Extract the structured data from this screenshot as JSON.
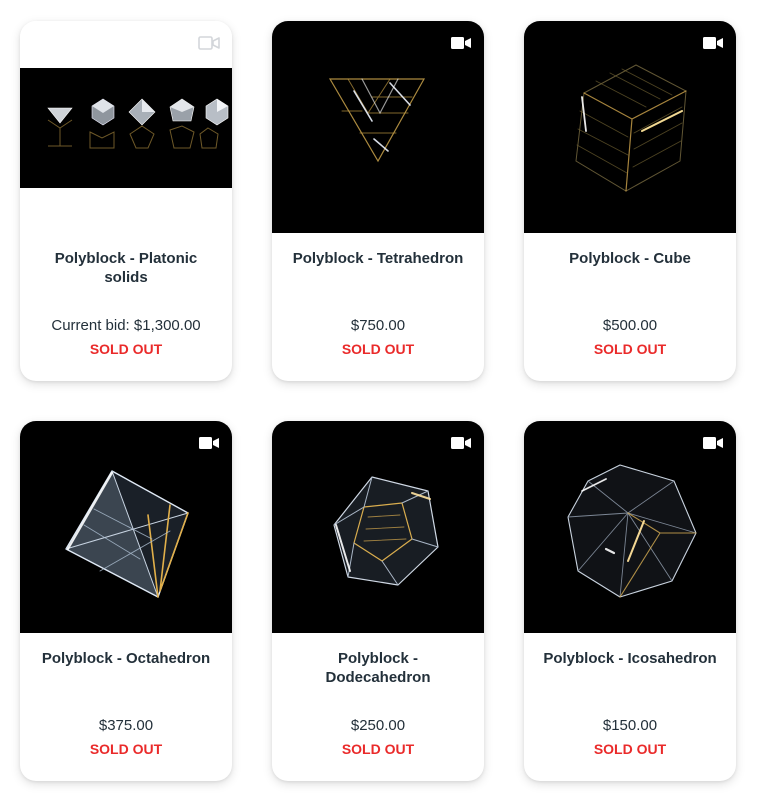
{
  "products": [
    {
      "title": "Polyblock - Platonic solids",
      "price": "Current bid: $1,300.00",
      "status": "SOLD OUT",
      "media_icon": "video-icon"
    },
    {
      "title": "Polyblock - Tetrahedron",
      "price": "$750.00",
      "status": "SOLD OUT",
      "media_icon": "video-icon"
    },
    {
      "title": "Polyblock - Cube",
      "price": "$500.00",
      "status": "SOLD OUT",
      "media_icon": "video-icon"
    },
    {
      "title": "Polyblock - Octahedron",
      "price": "$375.00",
      "status": "SOLD OUT",
      "media_icon": "video-icon"
    },
    {
      "title": "Polyblock - Dodecahedron",
      "price": "$250.00",
      "status": "SOLD OUT",
      "media_icon": "video-icon"
    },
    {
      "title": "Polyblock - Icosahedron",
      "price": "$150.00",
      "status": "SOLD OUT",
      "media_icon": "video-icon"
    }
  ],
  "colors": {
    "sold_out": "#ea2a2a",
    "text": "#23303a",
    "media_background": "#000000",
    "glow_gold": "#d9b15a",
    "glow_white": "#e8f0ff"
  }
}
